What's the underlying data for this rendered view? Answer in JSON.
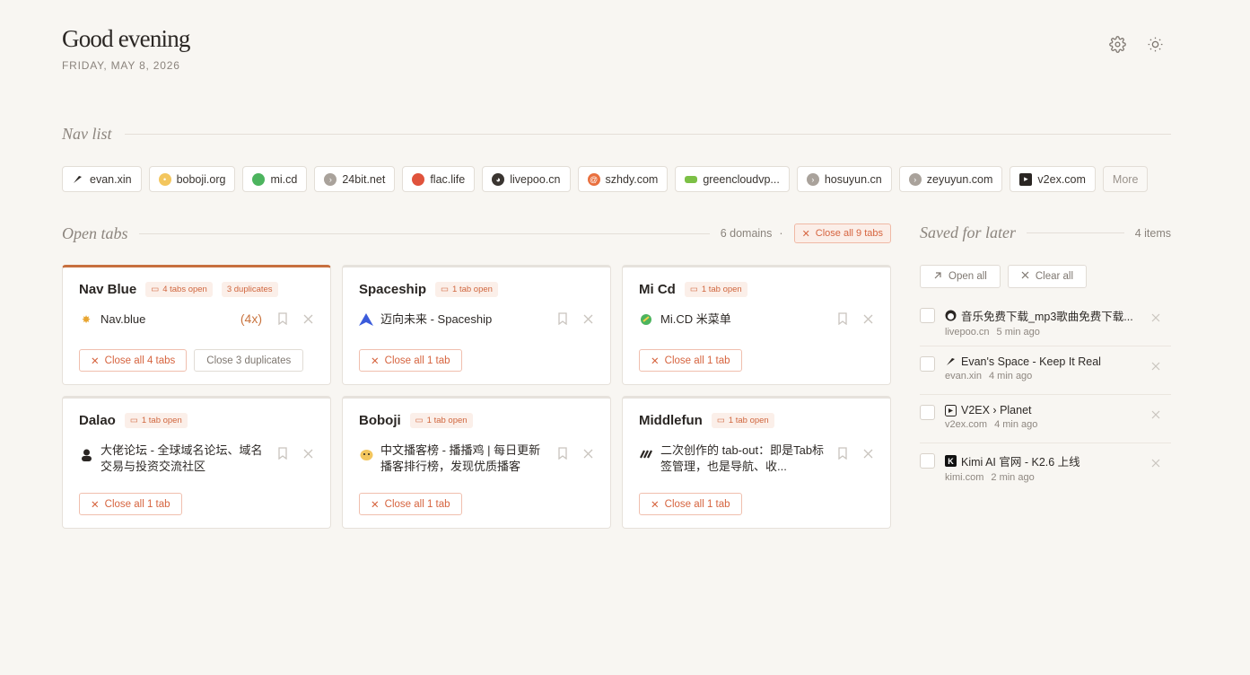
{
  "header": {
    "greeting": "Good evening",
    "date": "FRIDAY, MAY 8, 2026",
    "icons": [
      "gear-icon",
      "sun-icon"
    ]
  },
  "nav_list": {
    "title": "Nav list",
    "items": [
      {
        "label": "evan.xin",
        "icon": "feather-icon",
        "color": "#2a2623"
      },
      {
        "label": "boboji.org",
        "icon": "chick-icon",
        "color": "#e8b04a"
      },
      {
        "label": "mi.cd",
        "icon": "leaf-icon",
        "color": "#3aa55a"
      },
      {
        "label": "24bit.net",
        "icon": "arrow-circle-icon",
        "color": "#9c958e"
      },
      {
        "label": "flac.life",
        "icon": "red-circle-icon",
        "color": "#e0533c"
      },
      {
        "label": "livepoo.cn",
        "icon": "face-icon",
        "color": "#2a2623"
      },
      {
        "label": "szhdy.com",
        "icon": "swirl-icon",
        "color": "#e0653c"
      },
      {
        "label": "greencloudvp...",
        "icon": "green-cloud-icon",
        "color": "#6ab23a"
      },
      {
        "label": "hosuyun.cn",
        "icon": "arrow-circle-icon",
        "color": "#9c958e"
      },
      {
        "label": "zeyuyun.com",
        "icon": "arrow-circle-icon",
        "color": "#9c958e"
      },
      {
        "label": "v2ex.com",
        "icon": "v2ex-icon",
        "color": "#2a2623"
      }
    ],
    "more_label": "More"
  },
  "open_tabs": {
    "title": "Open tabs",
    "domains_label": "6 domains",
    "separator": "·",
    "close_all_label": "Close all 9 tabs",
    "cards": [
      {
        "name": "Nav Blue",
        "badge": "4 tabs open",
        "dup_badge": "3 duplicates",
        "tab_title": "Nav.blue",
        "tab_dup": "(4x)",
        "icon": "sun-favicon",
        "close_label": "Close all 4 tabs",
        "close_dups_label": "Close 3 duplicates"
      },
      {
        "name": "Spaceship",
        "badge": "1 tab open",
        "tab_title": "迈向未来 - Spaceship",
        "icon": "spaceship-icon",
        "close_label": "Close all 1 tab"
      },
      {
        "name": "Mi Cd",
        "badge": "1 tab open",
        "tab_title": "Mi.CD 米菜单",
        "icon": "leaf-icon",
        "close_label": "Close all 1 tab"
      },
      {
        "name": "Dalao",
        "badge": "1 tab open",
        "tab_title": "大佬论坛 - 全球域名论坛、域名交易与投资交流社区",
        "icon": "avatar-icon",
        "close_label": "Close all 1 tab"
      },
      {
        "name": "Boboji",
        "badge": "1 tab open",
        "tab_title": "中文播客榜 - 播播鸡 | 每日更新播客排行榜，发现优质播客",
        "icon": "chick-icon",
        "close_label": "Close all 1 tab"
      },
      {
        "name": "Middlefun",
        "badge": "1 tab open",
        "tab_title": "二次创作的 tab-out：即是Tab标签管理，也是导航、收...",
        "icon": "stripes-icon",
        "close_label": "Close all 1 tab"
      }
    ]
  },
  "saved": {
    "title": "Saved for later",
    "count": "4 items",
    "open_all": "Open all",
    "clear_all": "Clear all",
    "items": [
      {
        "title": "音乐免费下载_mp3歌曲免费下载...",
        "domain": "livepoo.cn",
        "time": "5 min ago",
        "icon": "face-icon"
      },
      {
        "title": "Evan's Space - Keep It Real",
        "domain": "evan.xin",
        "time": "4 min ago",
        "icon": "feather-icon"
      },
      {
        "title": "V2EX › Planet",
        "domain": "v2ex.com",
        "time": "4 min ago",
        "icon": "v2ex-icon"
      },
      {
        "title": "Kimi AI 官网 - K2.6 上线",
        "domain": "kimi.com",
        "time": "2 min ago",
        "icon": "kimi-icon"
      }
    ]
  }
}
